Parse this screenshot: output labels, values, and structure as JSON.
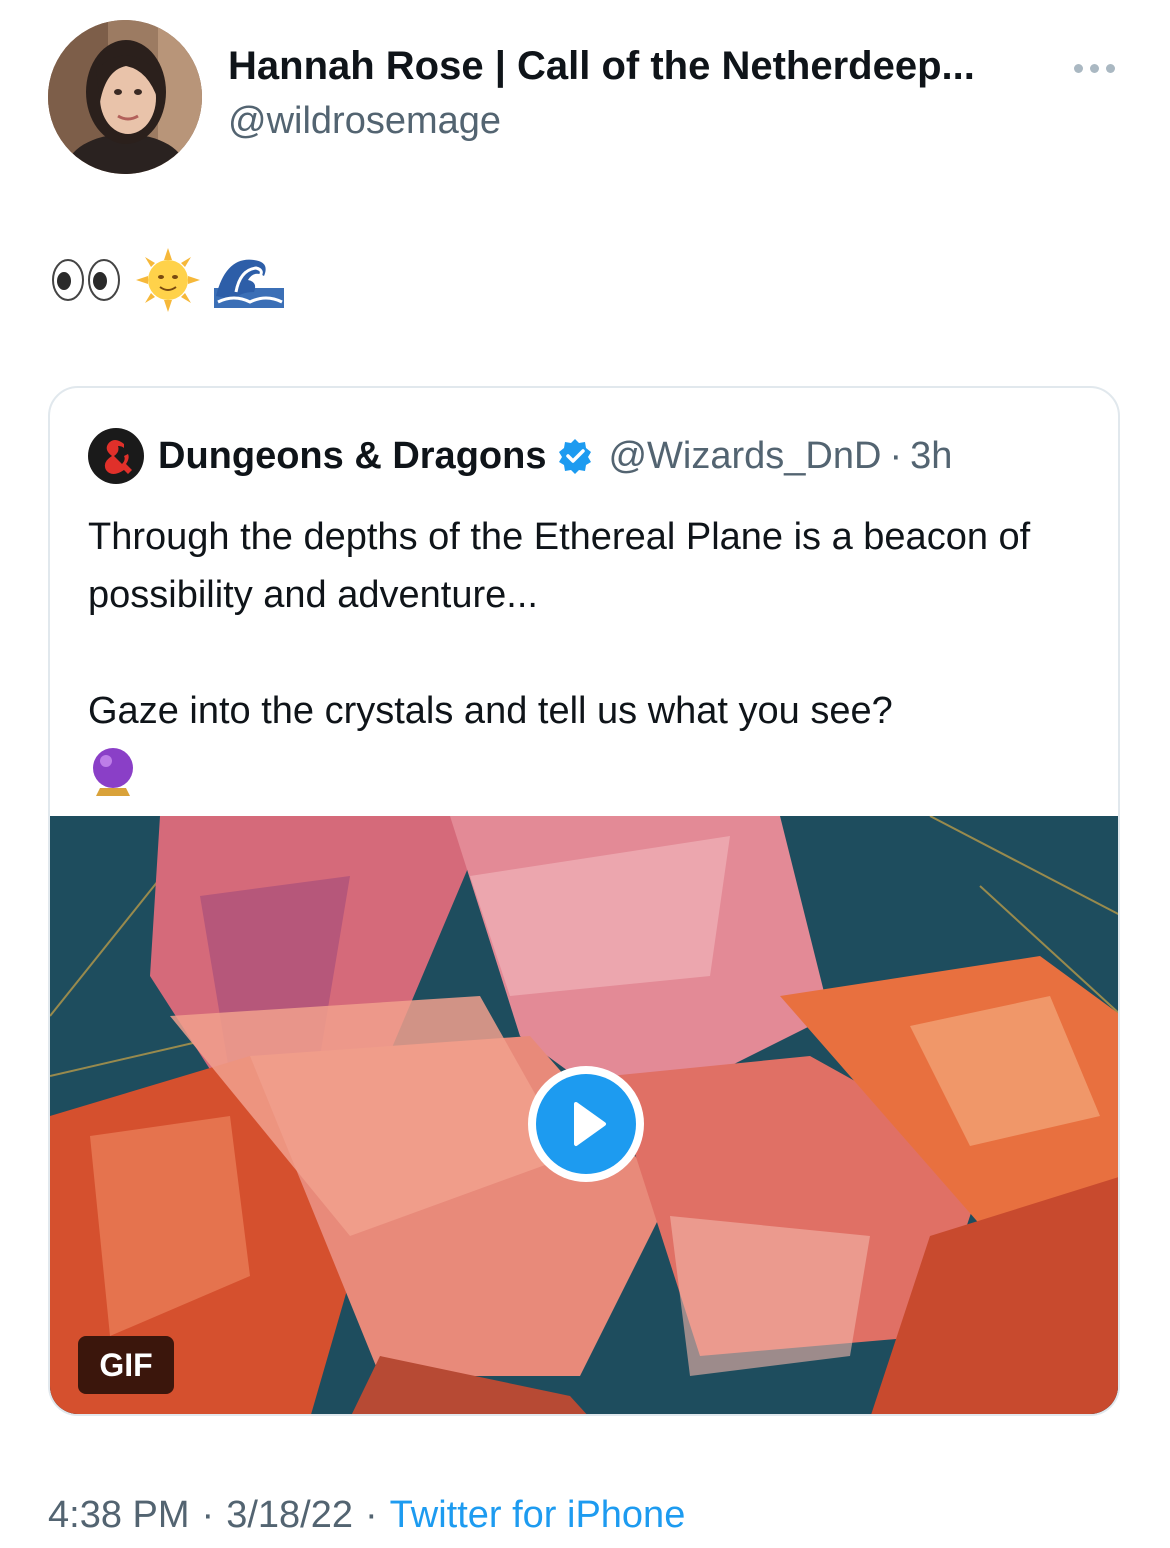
{
  "author": {
    "display_name": "Hannah Rose | Call of the Netherdeep...",
    "handle": "@wildrosemage",
    "avatar_icon": "user-avatar-photo"
  },
  "tweet": {
    "emoji": [
      "👀",
      "🌞",
      "🌊"
    ]
  },
  "quoted_tweet": {
    "display_name": "Dungeons & Dragons",
    "verified": true,
    "handle": "@Wizards_DnD",
    "separator": "·",
    "time": "3h",
    "avatar_icon": "ampersand-dragon-logo-icon",
    "text_lines": [
      "Through the depths of the Ethereal Plane is a beacon of possibility and adventure...",
      "Gaze into the crystals and tell us what you see?"
    ],
    "trailing_emoji": "🔮",
    "media": {
      "badge": "GIF",
      "play_icon": "play-icon"
    }
  },
  "meta": {
    "time": "4:38 PM",
    "date": "3/18/22",
    "separator": "·",
    "source": "Twitter for iPhone"
  },
  "colors": {
    "accent": "#1d9bf0",
    "secondary_text": "#536471",
    "primary_text": "#0f1419",
    "border": "#e1e8ed"
  }
}
